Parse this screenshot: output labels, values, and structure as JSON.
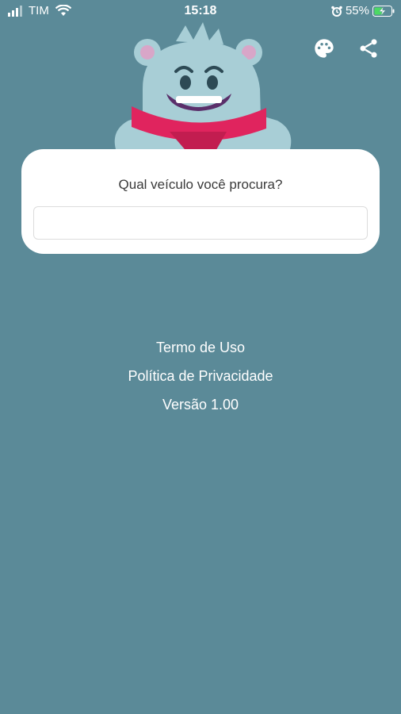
{
  "status_bar": {
    "carrier": "TIM",
    "time": "15:18",
    "battery": "55%",
    "icons": [
      "signal-icon",
      "wifi-icon",
      "alarm-icon",
      "battery-charging-icon"
    ]
  },
  "toolbar": {
    "icons": [
      "palette-icon",
      "share-icon"
    ]
  },
  "search": {
    "prompt": "Qual veículo você procura?",
    "value": "",
    "placeholder": ""
  },
  "footer": {
    "terms": "Termo de Uso",
    "privacy": "Política de Privacidade",
    "version": "Versão 1.00"
  },
  "colors": {
    "background": "#5b8a98",
    "card": "#ffffff",
    "mascot_fur": "#a8ced6",
    "scarf": "#e0245e"
  }
}
